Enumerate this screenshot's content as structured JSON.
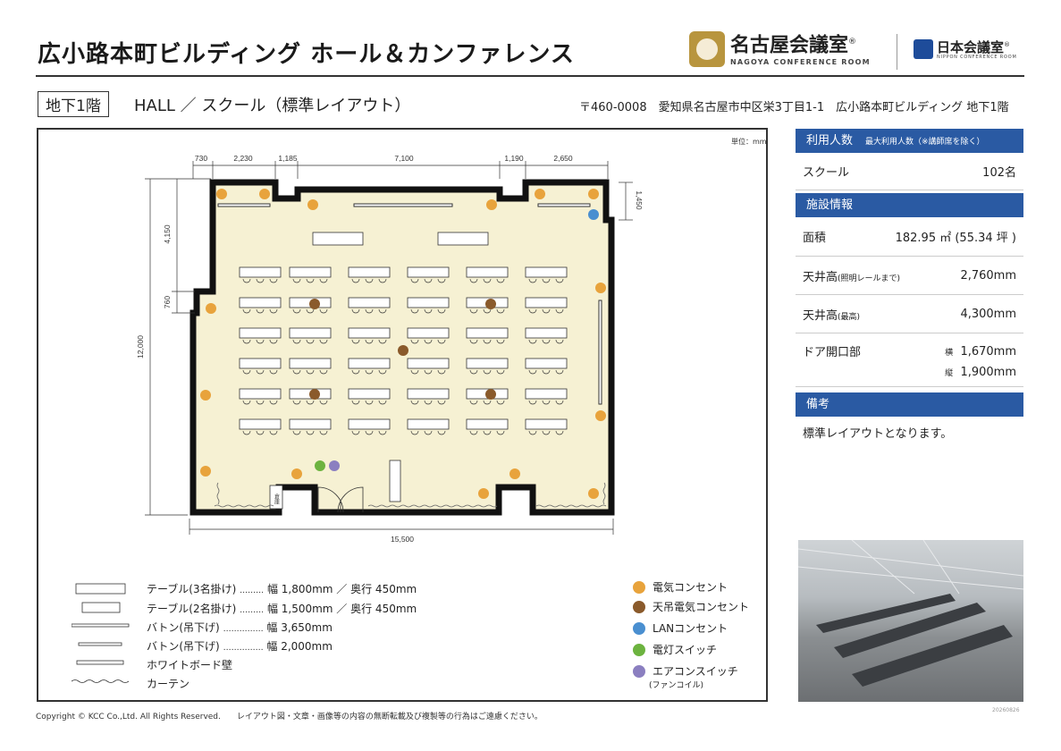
{
  "header": {
    "title": "広小路本町ビルディング ホール＆カンファレンス",
    "logo1_title": "名古屋会議室",
    "logo1_sub": "NAGOYA CONFERENCE ROOM",
    "logo2_title": "日本会議室",
    "logo2_sub": "NIPPON CONFERENCE ROOM",
    "registered": "®"
  },
  "subheader": {
    "floor": "地下1階",
    "layout": "HALL ／ スクール（標準レイアウト）",
    "address": "〒460-0008　愛知県名古屋市中区栄3丁目1-1　広小路本町ビルディング 地下1階"
  },
  "plan": {
    "unit": "単位：mm",
    "dims_top": [
      "730",
      "2,230",
      "1,185",
      "7,100",
      "1,190",
      "2,650"
    ],
    "dim_right": "1,450",
    "dim_left_top": "4,150",
    "dim_left_mid": "760",
    "dim_left_total": "12,000",
    "dim_bottom": "15,500",
    "storage_label": "倉庫"
  },
  "sidebar": {
    "capacity_head": "利用人数",
    "capacity_note": "最大利用人数（※講師席を除く）",
    "school_label": "スクール",
    "school_value": "102名",
    "facility_head": "施設情報",
    "area_label": "面積",
    "area_value": "182.95 ㎡ (55.34 坪 )",
    "ceiling1_label": "天井高",
    "ceiling1_note": "(照明レールまで)",
    "ceiling1_value": "2,760mm",
    "ceiling2_label": "天井高",
    "ceiling2_note": "(最高)",
    "ceiling2_value": "4,300mm",
    "door_label": "ドア開口部",
    "door_w_label": "横",
    "door_w_value": "1,670mm",
    "door_h_label": "縦",
    "door_h_value": "1,900mm",
    "notes_head": "備考",
    "notes_text": "標準レイアウトとなります。"
  },
  "legend": {
    "table3": "テーブル(3名掛け)",
    "table3_dots": "………",
    "table3_spec": "幅 1,800mm ／ 奥行 450mm",
    "table2": "テーブル(2名掛け)",
    "table2_dots": "………",
    "table2_spec": "幅 1,500mm ／ 奥行 450mm",
    "baton1": "バトン(吊下げ)",
    "baton1_dots": "……………",
    "baton1_spec": "幅 3,650mm",
    "baton2": "バトン(吊下げ)",
    "baton2_dots": "……………",
    "baton2_spec": "幅 2,000mm",
    "whiteboard": "ホワイトボード壁",
    "curtain": "カーテン",
    "outlet": "電気コンセント",
    "ceiling_outlet": "天吊電気コンセント",
    "lan": "LANコンセント",
    "light_switch": "電灯スイッチ",
    "ac_switch": "エアコンスイッチ",
    "ac_note": "(ファンコイル)"
  },
  "colors": {
    "floor": "#f6f1d3",
    "wall": "#111111",
    "outlet": "#e8a33c",
    "ceiling_outlet": "#8a5a2b",
    "lan": "#4a8fd0",
    "light_switch": "#6cb33f",
    "ac_switch": "#8b7fc0",
    "accent": "#2a5aa3"
  },
  "footer": {
    "copyright": "Copyright © KCC Co.,Ltd. All Rights Reserved.　　レイアウト図・文章・画像等の内容の無断転載及び複製等の行為はご遠慮ください。",
    "stamp": "20260826"
  }
}
